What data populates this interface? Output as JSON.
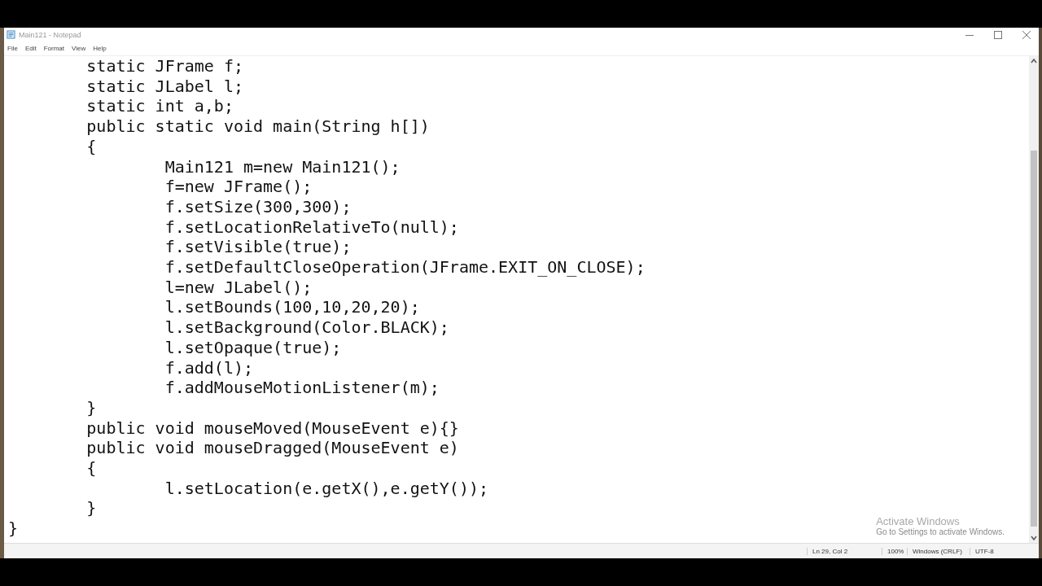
{
  "window": {
    "title": "Main121 - Notepad"
  },
  "menu": [
    "File",
    "Edit",
    "Format",
    "View",
    "Help"
  ],
  "editor": {
    "lines": [
      "\tstatic JFrame f;",
      "\tstatic JLabel l;",
      "\tstatic int a,b;",
      "\tpublic static void main(String h[])",
      "\t{",
      "\t\tMain121 m=new Main121();",
      "\t\tf=new JFrame();",
      "\t\tf.setSize(300,300);",
      "\t\tf.setLocationRelativeTo(null);",
      "\t\tf.setVisible(true);",
      "\t\tf.setDefaultCloseOperation(JFrame.EXIT_ON_CLOSE);",
      "\t\tl=new JLabel();",
      "\t\tl.setBounds(100,10,20,20);",
      "\t\tl.setBackground(Color.BLACK);",
      "\t\tl.setOpaque(true);",
      "\t\tf.add(l);",
      "\t\tf.addMouseMotionListener(m);",
      "\t}",
      "\tpublic void mouseMoved(MouseEvent e){}",
      "\tpublic void mouseDragged(MouseEvent e)",
      "\t{",
      "\t\tl.setLocation(e.getX(),e.getY());",
      "\t}",
      "}"
    ]
  },
  "activation": {
    "title": "Activate Windows",
    "subtitle": "Go to Settings to activate Windows."
  },
  "status_bar": {
    "position": "Ln 29, Col 2",
    "zoom": "100%",
    "line_endings": "Windows (CRLF)",
    "encoding": "UTF-8"
  }
}
